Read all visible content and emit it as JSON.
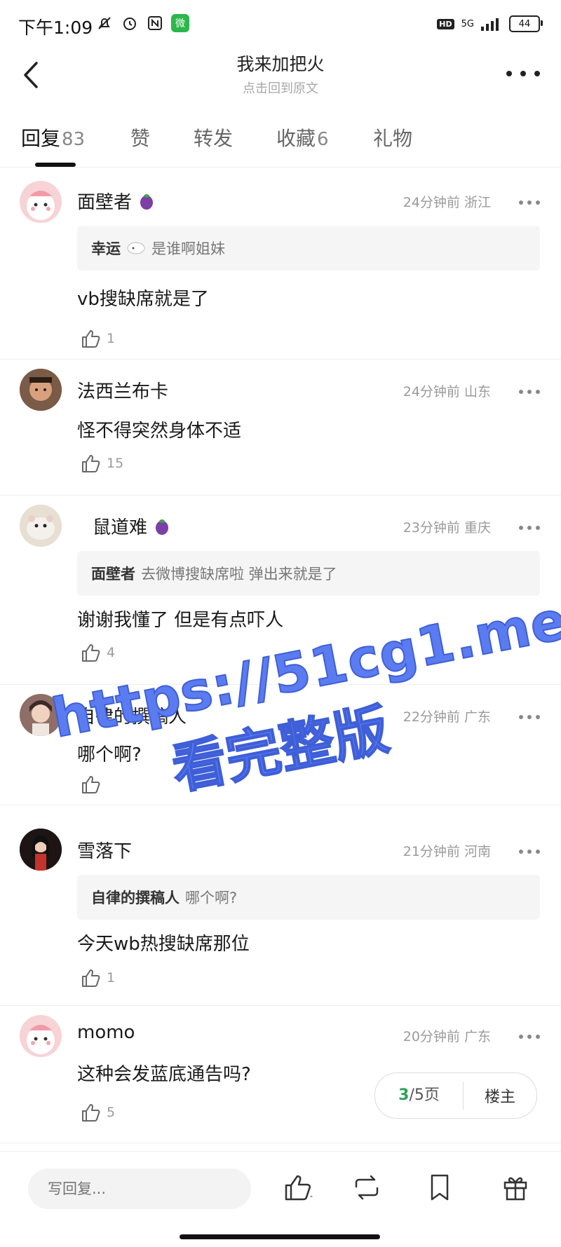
{
  "status_bar": {
    "time": "下午1:09",
    "network": "5G",
    "hd": "HD",
    "battery": "44",
    "wechat_icon": "微"
  },
  "header": {
    "title": "我来加把火",
    "subtitle": "点击回到原文"
  },
  "tabs": [
    {
      "label": "回复",
      "count": "83",
      "active": true
    },
    {
      "label": "赞",
      "count": ""
    },
    {
      "label": "转发",
      "count": ""
    },
    {
      "label": "收藏",
      "count": "6"
    },
    {
      "label": "礼物",
      "count": ""
    }
  ],
  "comments": [
    {
      "user": "面壁者",
      "badge": "eggplant",
      "time": "24分钟前",
      "location": "浙江",
      "quote_user": "幸运",
      "quote_text": "是谁啊姐妹",
      "text": "vb搜缺席就是了",
      "likes": "1"
    },
    {
      "user": "法西兰布卡",
      "badge": "",
      "time": "24分钟前",
      "location": "山东",
      "quote_user": "",
      "quote_text": "",
      "text": "怪不得突然身体不适",
      "likes": "15"
    },
    {
      "user": "鼠道难",
      "badge": "eggplant",
      "time": "23分钟前",
      "location": "重庆",
      "quote_user": "面壁者",
      "quote_text": "去微博搜缺席啦 弹出来就是了",
      "text": "谢谢我懂了  但是有点吓人",
      "likes": "4"
    },
    {
      "user": "自律的撰稿人",
      "badge": "",
      "time": "22分钟前",
      "location": "广东",
      "quote_user": "",
      "quote_text": "",
      "text": "哪个啊?",
      "likes": ""
    },
    {
      "user": "雪落下",
      "badge": "",
      "time": "21分钟前",
      "location": "河南",
      "quote_user": "自律的撰稿人",
      "quote_text": "哪个啊?",
      "text": "今天wb热搜缺席那位",
      "likes": "1"
    },
    {
      "user": "momo",
      "badge": "",
      "time": "20分钟前",
      "location": "广东",
      "quote_user": "",
      "quote_text": "",
      "text": "这种会发蓝底通告吗?",
      "likes": "5"
    }
  ],
  "pager": {
    "current": "3",
    "total_label": "/5页",
    "owner_label": "楼主"
  },
  "bottom_bar": {
    "reply_placeholder": "写回复..."
  },
  "watermark": {
    "line1": "https://51cg1.me",
    "line2": "看完整版",
    "color": "#5b7bf0"
  },
  "colors": {
    "accent_green": "#2ea15a",
    "quote_bg": "#f5f5f5"
  }
}
